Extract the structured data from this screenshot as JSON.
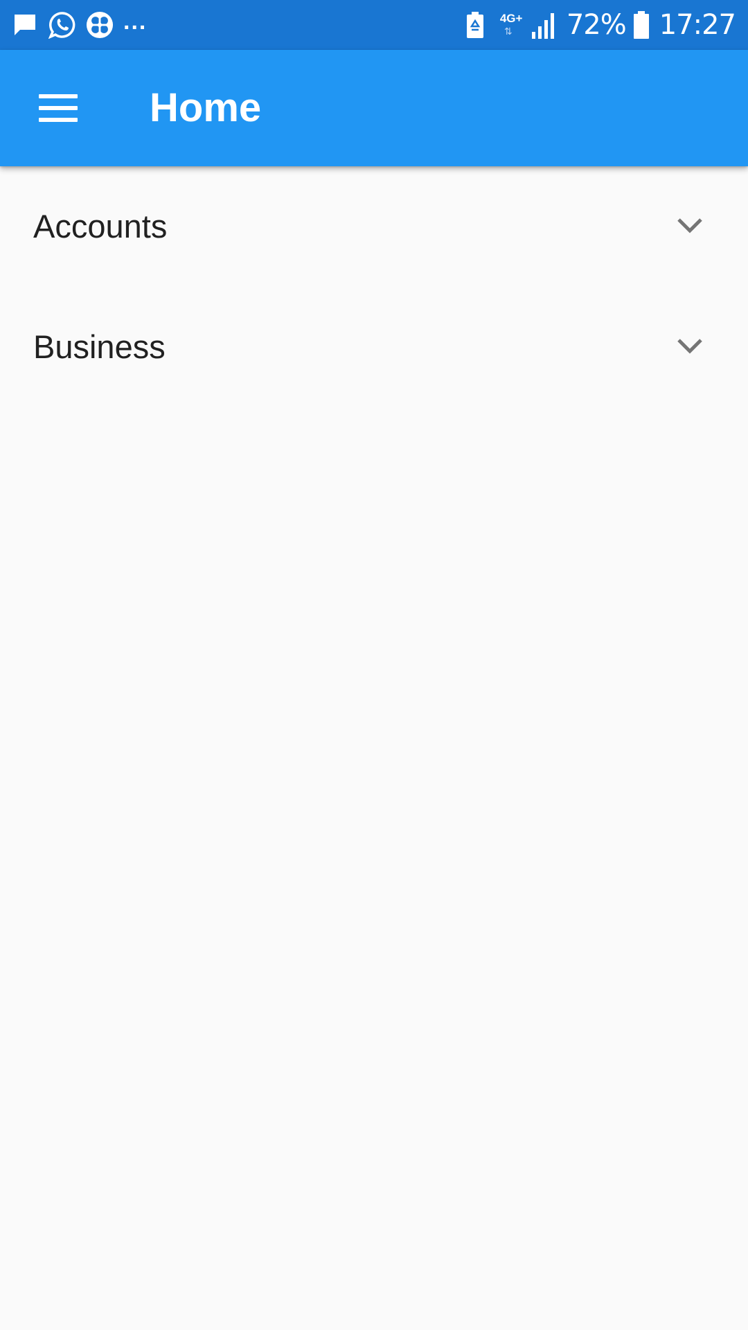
{
  "status_bar": {
    "left_icons": [
      "message-icon",
      "whatsapp-icon",
      "clover-app-icon"
    ],
    "overflow": "...",
    "network_type": "4G+",
    "battery_percent": "72%",
    "time": "17:27",
    "background_color": "#1976d2"
  },
  "app_bar": {
    "title": "Home",
    "menu_icon": "hamburger-menu-icon",
    "background_color": "#2196f3"
  },
  "list": {
    "items": [
      {
        "label": "Accounts",
        "icon": "chevron-down-icon",
        "expanded": false
      },
      {
        "label": "Business",
        "icon": "chevron-down-icon",
        "expanded": false
      }
    ]
  }
}
